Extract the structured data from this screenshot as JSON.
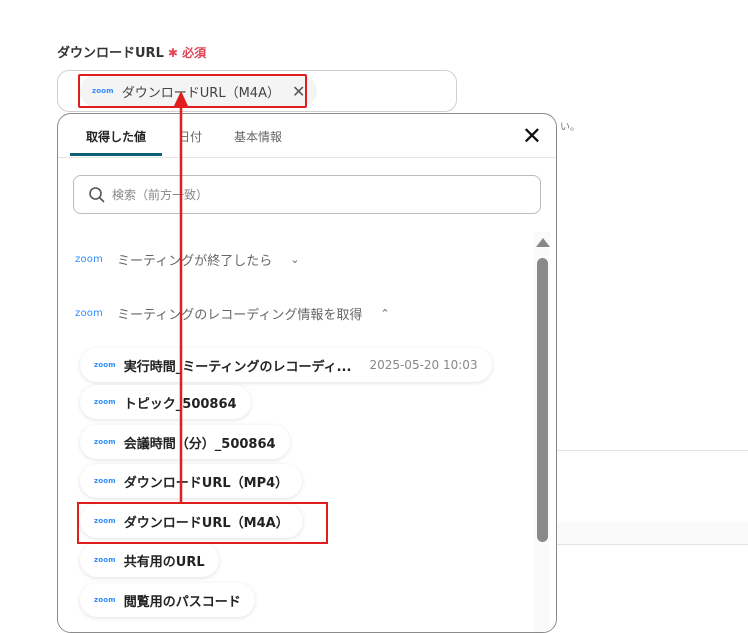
{
  "field": {
    "label": "ダウンロードURL",
    "required_mark": "✱",
    "required_label": "必須",
    "selected_chip": {
      "source": "zoom",
      "label": "ダウンロードURL（M4A）"
    }
  },
  "background_text": "い。",
  "popup": {
    "tabs": [
      {
        "label": "取得した値",
        "active": true
      },
      {
        "label": "日付"
      },
      {
        "label": "基本情報"
      }
    ],
    "search_placeholder": "検索（前方一致）",
    "sections": [
      {
        "source": "zoom",
        "label": "ミーティングが終了したら",
        "expanded": false
      },
      {
        "source": "zoom",
        "label": "ミーティングのレコーディング情報を取得",
        "expanded": true
      }
    ],
    "items": [
      {
        "source": "zoom",
        "label": "実行時間_ミーティングのレコーディ...",
        "value": "2025-05-20 10:03"
      },
      {
        "source": "zoom",
        "label": "トピック_500864"
      },
      {
        "source": "zoom",
        "label": "会議時間（分）_500864"
      },
      {
        "source": "zoom",
        "label": "ダウンロードURL（MP4）"
      },
      {
        "source": "zoom",
        "label": "ダウンロードURL（M4A）",
        "highlighted": true
      },
      {
        "source": "zoom",
        "label": "共有用のURL"
      },
      {
        "source": "zoom",
        "label": "閲覧用のパスコード"
      }
    ]
  },
  "colors": {
    "accent": "#0f5f75",
    "annotation": "#e01e1e",
    "required": "#e0455a",
    "zoom": "#2d8cff"
  }
}
